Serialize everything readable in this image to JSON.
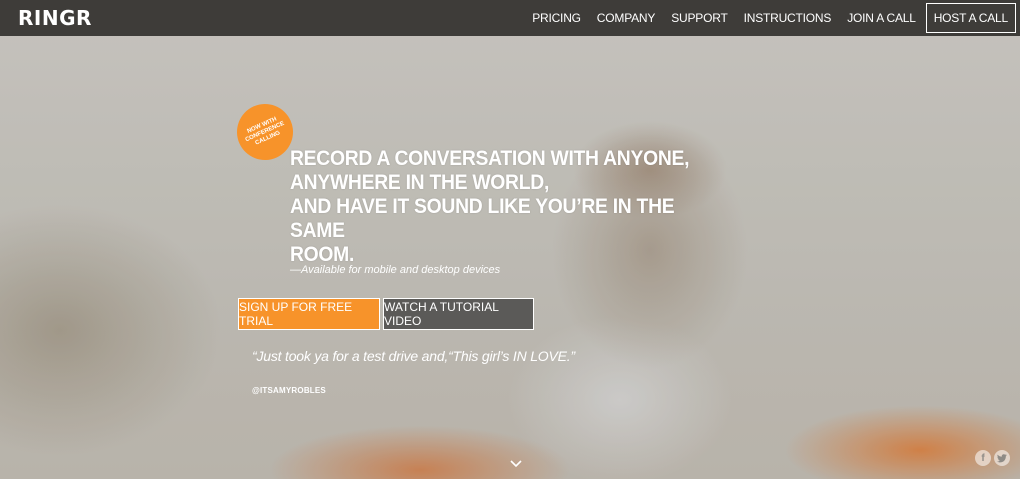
{
  "nav": {
    "logo": "RINGR",
    "links": [
      "PRICING",
      "COMPANY",
      "SUPPORT",
      "INSTRUCTIONS",
      "JOIN A CALL"
    ],
    "host_label": "HOST A CALL"
  },
  "hero": {
    "badge": "NOW WITH CONFERENCE CALLING",
    "headline_lines": [
      "RECORD A CONVERSATION WITH ANYONE,",
      "ANYWHERE IN THE WORLD,",
      "AND HAVE IT SOUND LIKE YOU’RE IN THE SAME",
      "ROOM."
    ],
    "subline": "—Available for mobile and desktop devices",
    "signup_label": "SIGN UP FOR FREE TRIAL",
    "video_label": "WATCH A TUTORIAL VIDEO",
    "quote": "“Just took ya for a test drive and,“This girl’s IN LOVE.”",
    "quote_author": "@ITSAMYROBLES"
  },
  "icons": {
    "scroll": "chevron-down-icon",
    "facebook": "facebook-icon",
    "twitter": "twitter-icon"
  },
  "colors": {
    "accent": "#f7932a",
    "nav_bg": "#3e3c39",
    "video_button": "#5b5a58"
  }
}
